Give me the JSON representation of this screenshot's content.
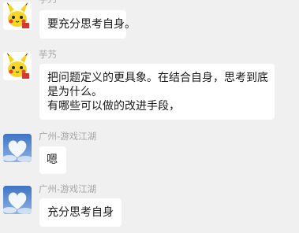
{
  "messages": [
    {
      "sender": "芋艿",
      "avatar": "pikachu-avatar",
      "lines": [
        "要充分思考自身。"
      ]
    },
    {
      "sender": "芋艿",
      "avatar": "pikachu-avatar",
      "lines": [
        "把问题定义的更具象。在结合自身，思考到底",
        "是为什么。",
        "有哪些可以做的改进手段，"
      ]
    },
    {
      "sender": "广州-游戏江湖",
      "avatar": "heart-cloud-avatar",
      "lines": [
        "嗯"
      ]
    },
    {
      "sender": "广州-游戏江湖",
      "avatar": "heart-cloud-avatar",
      "lines": [
        "充分思考自身"
      ]
    }
  ]
}
